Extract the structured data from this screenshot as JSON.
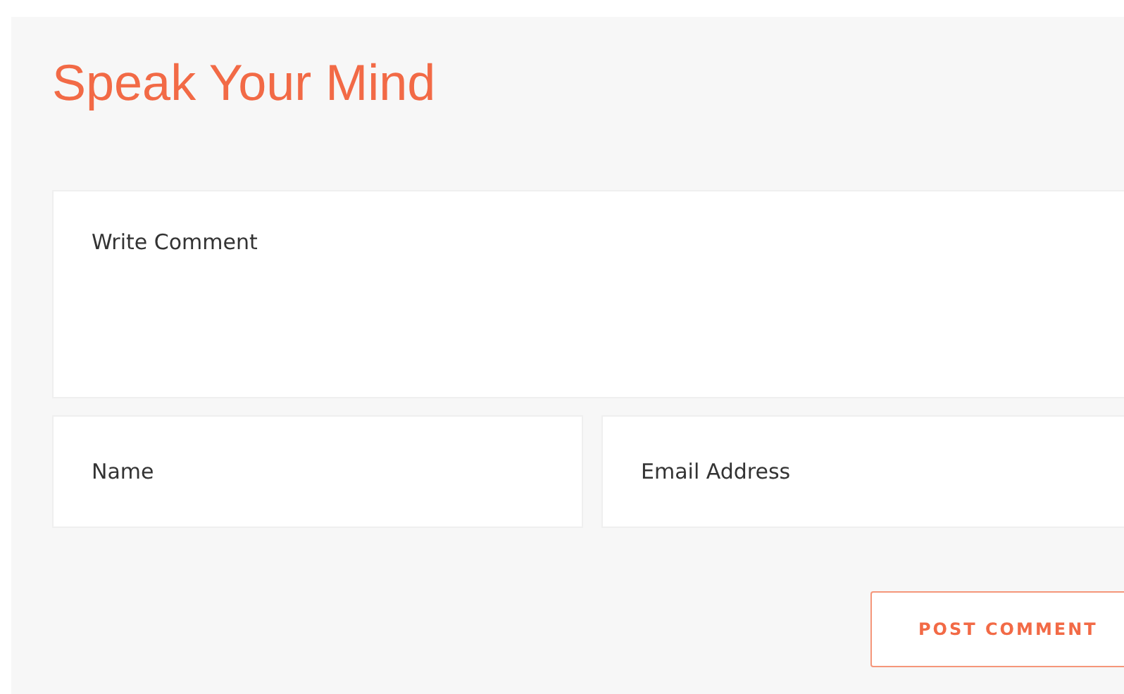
{
  "heading": "Speak Your Mind",
  "comment": {
    "placeholder": "Write Comment"
  },
  "name": {
    "placeholder": "Name"
  },
  "email": {
    "placeholder": "Email Address"
  },
  "submit": {
    "label": "POST COMMENT"
  }
}
